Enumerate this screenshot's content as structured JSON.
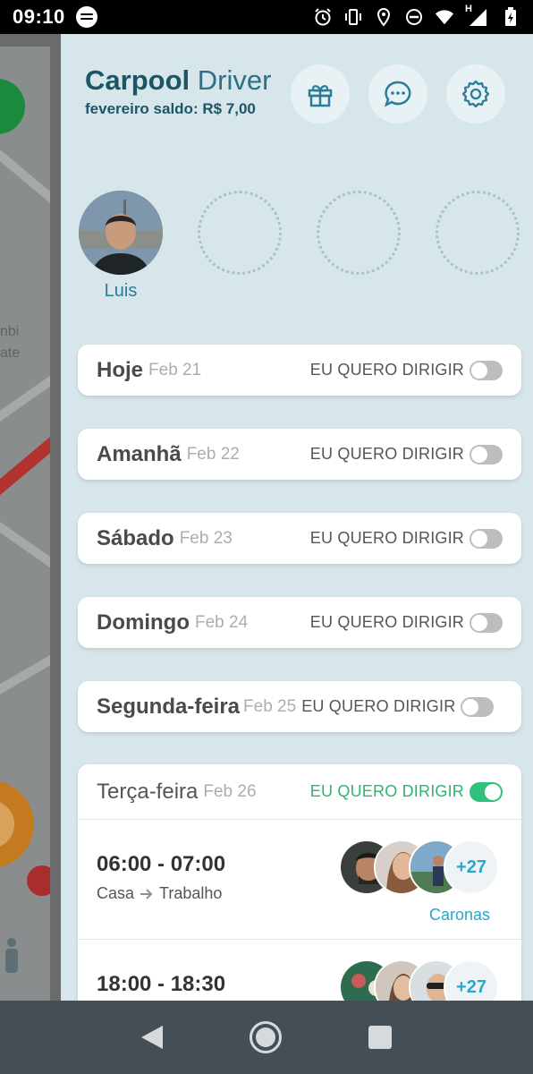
{
  "status_bar": {
    "time": "09:10",
    "icons": [
      "spotify-icon",
      "alarm-icon",
      "vibrate-icon",
      "location-icon",
      "dnd-icon",
      "wifi-icon",
      "signal-icon",
      "battery-icon"
    ],
    "network_label": "H"
  },
  "map": {
    "street_label_1": "nbi",
    "street_label_2": "ate"
  },
  "header": {
    "title_bold": "Carpool",
    "title_light": "Driver",
    "balance": "fevereiro saldo: R$ 7,00",
    "buttons": [
      "gift-icon",
      "chat-icon",
      "settings-icon"
    ]
  },
  "members": [
    {
      "name": "Luis",
      "filled": true
    },
    {
      "name": "",
      "filled": false
    },
    {
      "name": "",
      "filled": false
    },
    {
      "name": "",
      "filled": false
    }
  ],
  "drive_label": "EU QUERO DIRIGIR",
  "days": [
    {
      "name": "Hoje",
      "date": "Feb 21",
      "driving": false
    },
    {
      "name": "Amanhã",
      "date": "Feb 22",
      "driving": false
    },
    {
      "name": "Sábado",
      "date": "Feb 23",
      "driving": false
    },
    {
      "name": "Domingo",
      "date": "Feb 24",
      "driving": false
    },
    {
      "name": "Segunda-feira",
      "date": "Feb 25",
      "driving": false
    },
    {
      "name": "Terça-feira",
      "date": "Feb 26",
      "driving": true
    }
  ],
  "rides": [
    {
      "time": "06:00 - 07:00",
      "from": "Casa",
      "to": "Trabalho",
      "more_count": "+27",
      "link": "Caronas"
    },
    {
      "time": "18:00 - 18:30",
      "more_count": "+27"
    }
  ],
  "colors": {
    "panel_bg": "#d7e6ea",
    "brand_dark": "#1d5566",
    "accent_blue": "#2aa7c9",
    "toggle_on": "#2fc07a",
    "toggle_off": "#bdbdbd"
  }
}
